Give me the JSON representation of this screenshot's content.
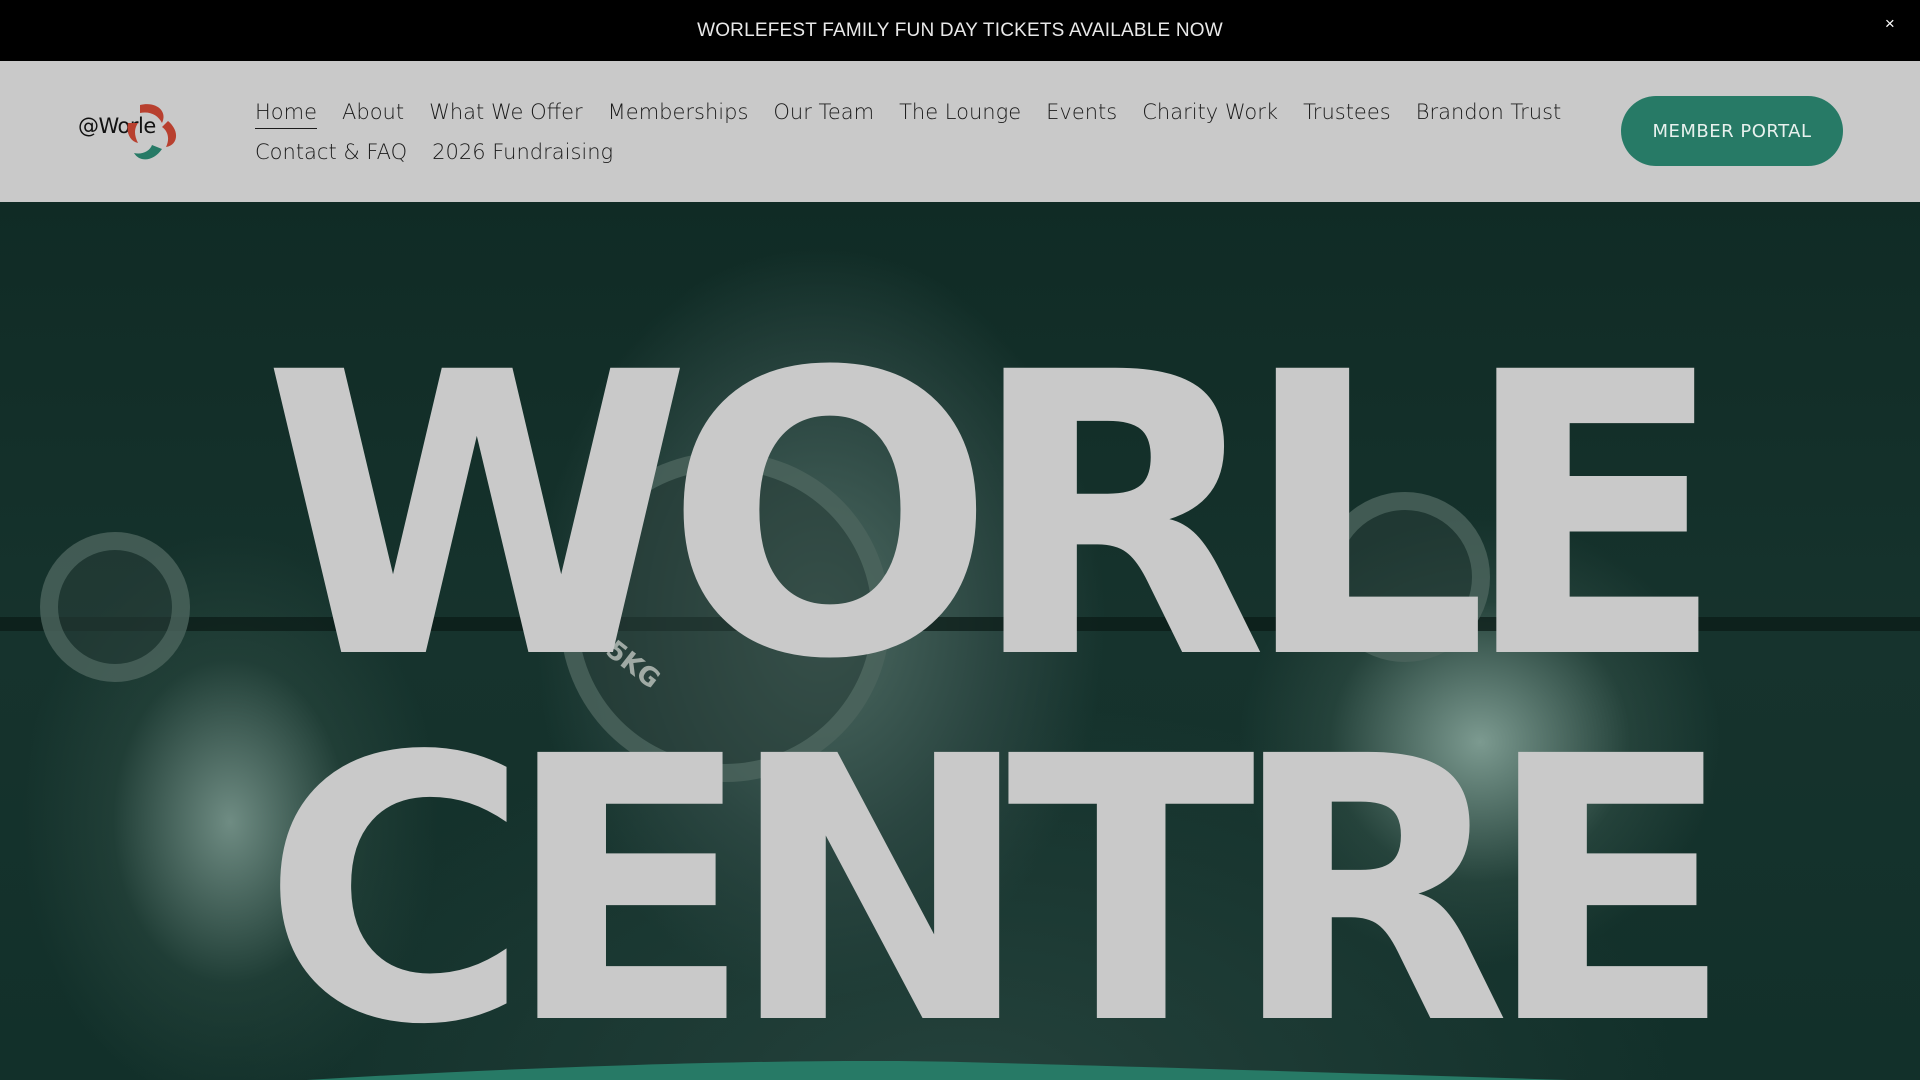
{
  "announcement": {
    "text": "WORLEFEST FAMILY FUN DAY TICKETS AVAILABLE NOW",
    "close_glyph": "×"
  },
  "header": {
    "logo_text": "@Worle",
    "logo_colors": {
      "red": "#b8402f",
      "green": "#277a66"
    },
    "nav": {
      "row1": [
        {
          "label": "Home",
          "active": true
        },
        {
          "label": "About"
        },
        {
          "label": "What We Offer"
        },
        {
          "label": "Memberships"
        },
        {
          "label": "Our Team"
        },
        {
          "label": "The Lounge"
        },
        {
          "label": "Events"
        },
        {
          "label": "Charity Work"
        },
        {
          "label": "Trustees"
        },
        {
          "label": "Brandon Trust"
        }
      ],
      "row2": [
        {
          "label": "Contact & FAQ"
        },
        {
          "label": "2026 Fundraising"
        }
      ]
    },
    "portal_button": "MEMBER PORTAL",
    "accent_color": "#277a66"
  },
  "hero": {
    "title_line1": "WORLE",
    "title_line2": "CENTRE",
    "plate_label": "5KG",
    "background_icon": "gym-photo-dumbbell-lift"
  }
}
